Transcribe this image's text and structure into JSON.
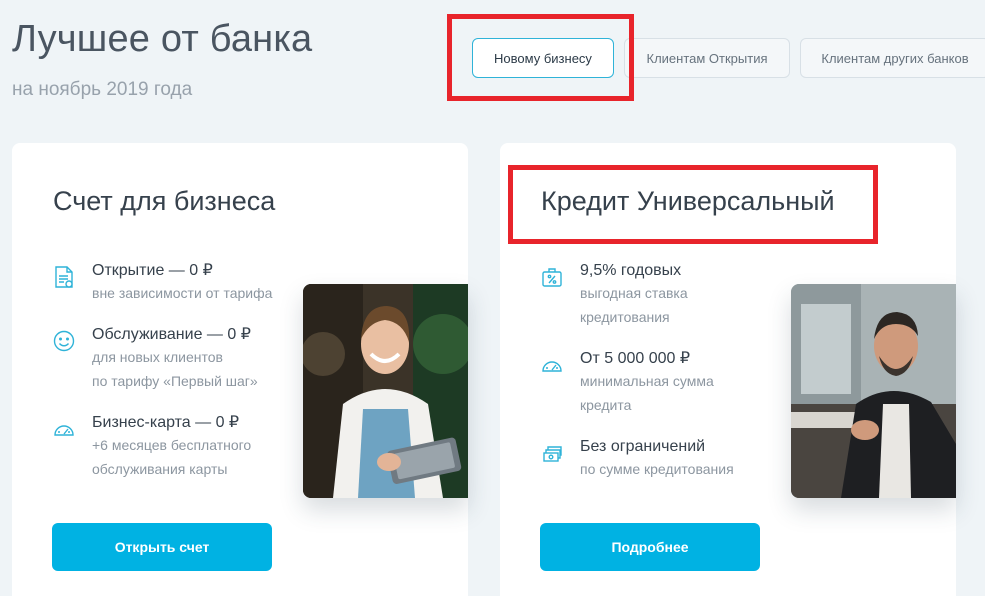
{
  "header": {
    "title": "Лучшее от банка",
    "subtitle": "на ноябрь 2019 года"
  },
  "tabs": [
    {
      "label": "Новому бизнесу",
      "active": true
    },
    {
      "label": "Клиентам Открытия",
      "active": false
    },
    {
      "label": "Клиентам других банков",
      "active": false
    }
  ],
  "cards": [
    {
      "title": "Счет для бизнеса",
      "features": [
        {
          "icon": "document-icon",
          "title": "Открытие — 0 ₽",
          "desc": "вне зависимости от тарифа"
        },
        {
          "icon": "smile-icon",
          "title": "Обслуживание — 0 ₽",
          "desc": "для новых клиентов\nпо тарифу «Первый шаг»"
        },
        {
          "icon": "speedometer-icon",
          "title": "Бизнес-карта — 0 ₽",
          "desc": "+6 месяцев бесплатного\nобслуживания карты"
        }
      ],
      "button": "Открыть счет"
    },
    {
      "title": "Кредит Универсальный",
      "features": [
        {
          "icon": "briefcase-percent-icon",
          "title": "9,5% годовых",
          "desc": "выгодная ставка\nкредитования"
        },
        {
          "icon": "speedometer-icon",
          "title": "От 5 000 000 ₽",
          "desc": "минимальная сумма\nкредита"
        },
        {
          "icon": "money-stack-icon",
          "title": "Без ограничений",
          "desc": "по сумме кредитования"
        }
      ],
      "button": "Подробнее"
    }
  ],
  "colors": {
    "accent": "#00b2e3",
    "highlight": "#e8242b",
    "background": "#eff4f7"
  }
}
